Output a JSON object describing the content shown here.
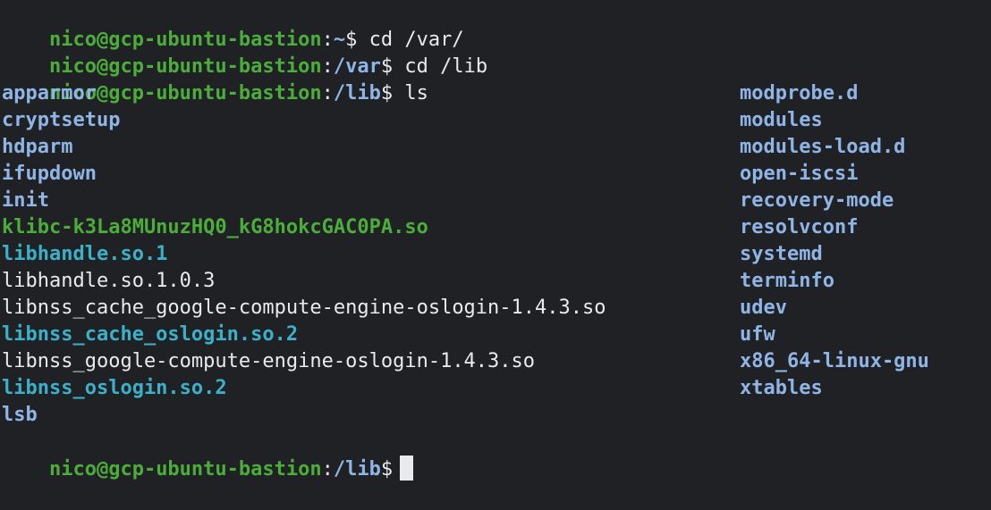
{
  "prompts": [
    {
      "user": "nico@gcp-ubuntu-bastion",
      "colon": ":",
      "path": "~",
      "dollar": "$ ",
      "command": "cd /var/"
    },
    {
      "user": "nico@gcp-ubuntu-bastion",
      "colon": ":",
      "path": "/var",
      "dollar": "$ ",
      "command": "cd /lib"
    },
    {
      "user": "nico@gcp-ubuntu-bastion",
      "colon": ":",
      "path": "/lib",
      "dollar": "$ ",
      "command": "ls"
    },
    {
      "user": "nico@gcp-ubuntu-bastion",
      "colon": ":",
      "path": "/lib",
      "dollar": "$",
      "command": ""
    }
  ],
  "listing": {
    "column1": [
      {
        "name": "apparmor",
        "kind": "dir"
      },
      {
        "name": "cryptsetup",
        "kind": "dir"
      },
      {
        "name": "hdparm",
        "kind": "dir"
      },
      {
        "name": "ifupdown",
        "kind": "dir"
      },
      {
        "name": "init",
        "kind": "dir"
      },
      {
        "name": "klibc-k3La8MUnuzHQ0_kG8hokcGAC0PA.so",
        "kind": "exec"
      },
      {
        "name": "libhandle.so.1",
        "kind": "link"
      },
      {
        "name": "libhandle.so.1.0.3",
        "kind": "file"
      },
      {
        "name": "libnss_cache_google-compute-engine-oslogin-1.4.3.so",
        "kind": "file"
      },
      {
        "name": "libnss_cache_oslogin.so.2",
        "kind": "link"
      },
      {
        "name": "libnss_google-compute-engine-oslogin-1.4.3.so",
        "kind": "file"
      },
      {
        "name": "libnss_oslogin.so.2",
        "kind": "link"
      },
      {
        "name": "lsb",
        "kind": "dir"
      }
    ],
    "column2": [
      {
        "name": "modprobe.d",
        "kind": "dir"
      },
      {
        "name": "modules",
        "kind": "dir"
      },
      {
        "name": "modules-load.d",
        "kind": "dir"
      },
      {
        "name": "open-iscsi",
        "kind": "dir"
      },
      {
        "name": "recovery-mode",
        "kind": "dir"
      },
      {
        "name": "resolvconf",
        "kind": "dir"
      },
      {
        "name": "systemd",
        "kind": "dir"
      },
      {
        "name": "terminfo",
        "kind": "dir"
      },
      {
        "name": "udev",
        "kind": "dir"
      },
      {
        "name": "ufw",
        "kind": "dir"
      },
      {
        "name": "x86_64-linux-gnu",
        "kind": "dir"
      },
      {
        "name": "xtables",
        "kind": "dir"
      }
    ]
  },
  "colors": {
    "background": "#202124",
    "user_prompt": "#4cae3a",
    "path": "#8fb5e6",
    "directory": "#8fb5e6",
    "executable": "#4cae3a",
    "symlink": "#3bb0c9",
    "plain_file": "#e8eaed"
  }
}
